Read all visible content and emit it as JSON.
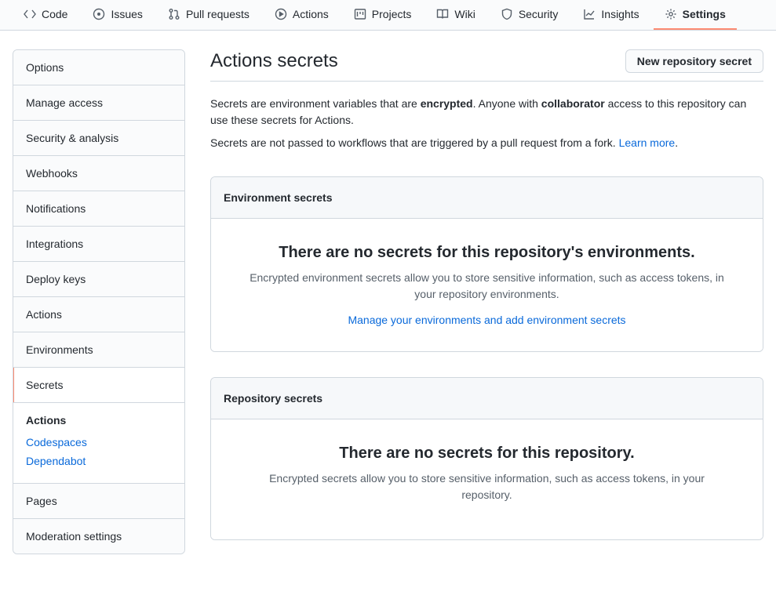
{
  "tabs": {
    "code": "Code",
    "issues": "Issues",
    "pulls": "Pull requests",
    "actions": "Actions",
    "projects": "Projects",
    "wiki": "Wiki",
    "security": "Security",
    "insights": "Insights",
    "settings": "Settings"
  },
  "sidebar": {
    "options": "Options",
    "manage_access": "Manage access",
    "security_analysis": "Security & analysis",
    "webhooks": "Webhooks",
    "notifications": "Notifications",
    "integrations": "Integrations",
    "deploy_keys": "Deploy keys",
    "actions": "Actions",
    "environments": "Environments",
    "secrets": "Secrets",
    "secrets_sub": {
      "actions": "Actions",
      "codespaces": "Codespaces",
      "dependabot": "Dependabot"
    },
    "pages": "Pages",
    "moderation": "Moderation settings"
  },
  "page": {
    "title": "Actions secrets",
    "new_secret_btn": "New repository secret",
    "intro1_a": "Secrets are environment variables that are ",
    "intro1_b": "encrypted",
    "intro1_c": ". Anyone with ",
    "intro1_d": "collaborator",
    "intro1_e": " access to this repository can use these secrets for Actions.",
    "intro2_a": "Secrets are not passed to workflows that are triggered by a pull request from a fork. ",
    "intro2_link": "Learn more",
    "intro2_dot": "."
  },
  "env_panel": {
    "title": "Environment secrets",
    "empty_title": "There are no secrets for this repository's environments.",
    "empty_desc": "Encrypted environment secrets allow you to store sensitive information, such as access tokens, in your repository environments.",
    "manage_link": "Manage your environments and add environment secrets"
  },
  "repo_panel": {
    "title": "Repository secrets",
    "empty_title": "There are no secrets for this repository.",
    "empty_desc": "Encrypted secrets allow you to store sensitive information, such as access tokens, in your repository."
  }
}
